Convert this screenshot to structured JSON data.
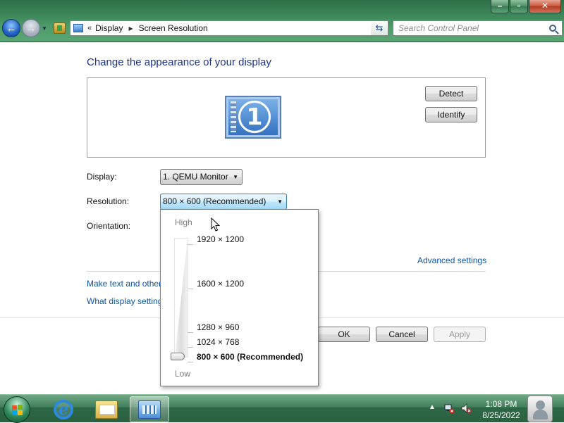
{
  "window": {
    "caption": {
      "minimize": "–",
      "maximize": "▫",
      "close": "✕"
    }
  },
  "nav": {
    "back_glyph": "←",
    "forward_glyph": "→",
    "dropdown_glyph": "▼"
  },
  "address": {
    "overflow": "«",
    "crumbs": [
      "Display",
      "Screen Resolution"
    ],
    "separator": "▶",
    "dropdown_glyph": "▼",
    "refresh_glyph": "⇆"
  },
  "search": {
    "placeholder": "Search Control Panel"
  },
  "page": {
    "title": "Change the appearance of your display",
    "monitor_number": "1",
    "detect_label": "Detect",
    "identify_label": "Identify"
  },
  "fields": {
    "display_label": "Display:",
    "display_value": "1. QEMU Monitor",
    "resolution_label": "Resolution:",
    "resolution_value": "800 × 600 (Recommended)",
    "orientation_label": "Orientation:",
    "dropdown_glyph": "▼"
  },
  "links": {
    "advanced": "Advanced settings",
    "text_size": "Make text and other",
    "which_settings": "What display setting"
  },
  "buttons": {
    "ok": "OK",
    "cancel": "Cancel",
    "apply": "Apply"
  },
  "resolution_dropdown": {
    "high_label": "High",
    "low_label": "Low",
    "options": [
      {
        "label": "1920 × 1200",
        "selected": false
      },
      {
        "label": "1600 × 1200",
        "selected": false
      },
      {
        "label": "1280 × 960",
        "selected": false
      },
      {
        "label": "1024 × 768",
        "selected": false
      },
      {
        "label": "800 × 600 (Recommended)",
        "selected": true
      }
    ]
  },
  "taskbar": {
    "items": [
      "internet-explorer",
      "windows-explorer",
      "control-panel"
    ],
    "active_item": "control-panel",
    "tray_arrow": "▲",
    "time": "1:08 PM",
    "date": "8/25/2022"
  },
  "colors": {
    "title_blue": "#1e3287",
    "link_blue": "#0d56a6",
    "chrome_green": "#3f8a5c"
  }
}
